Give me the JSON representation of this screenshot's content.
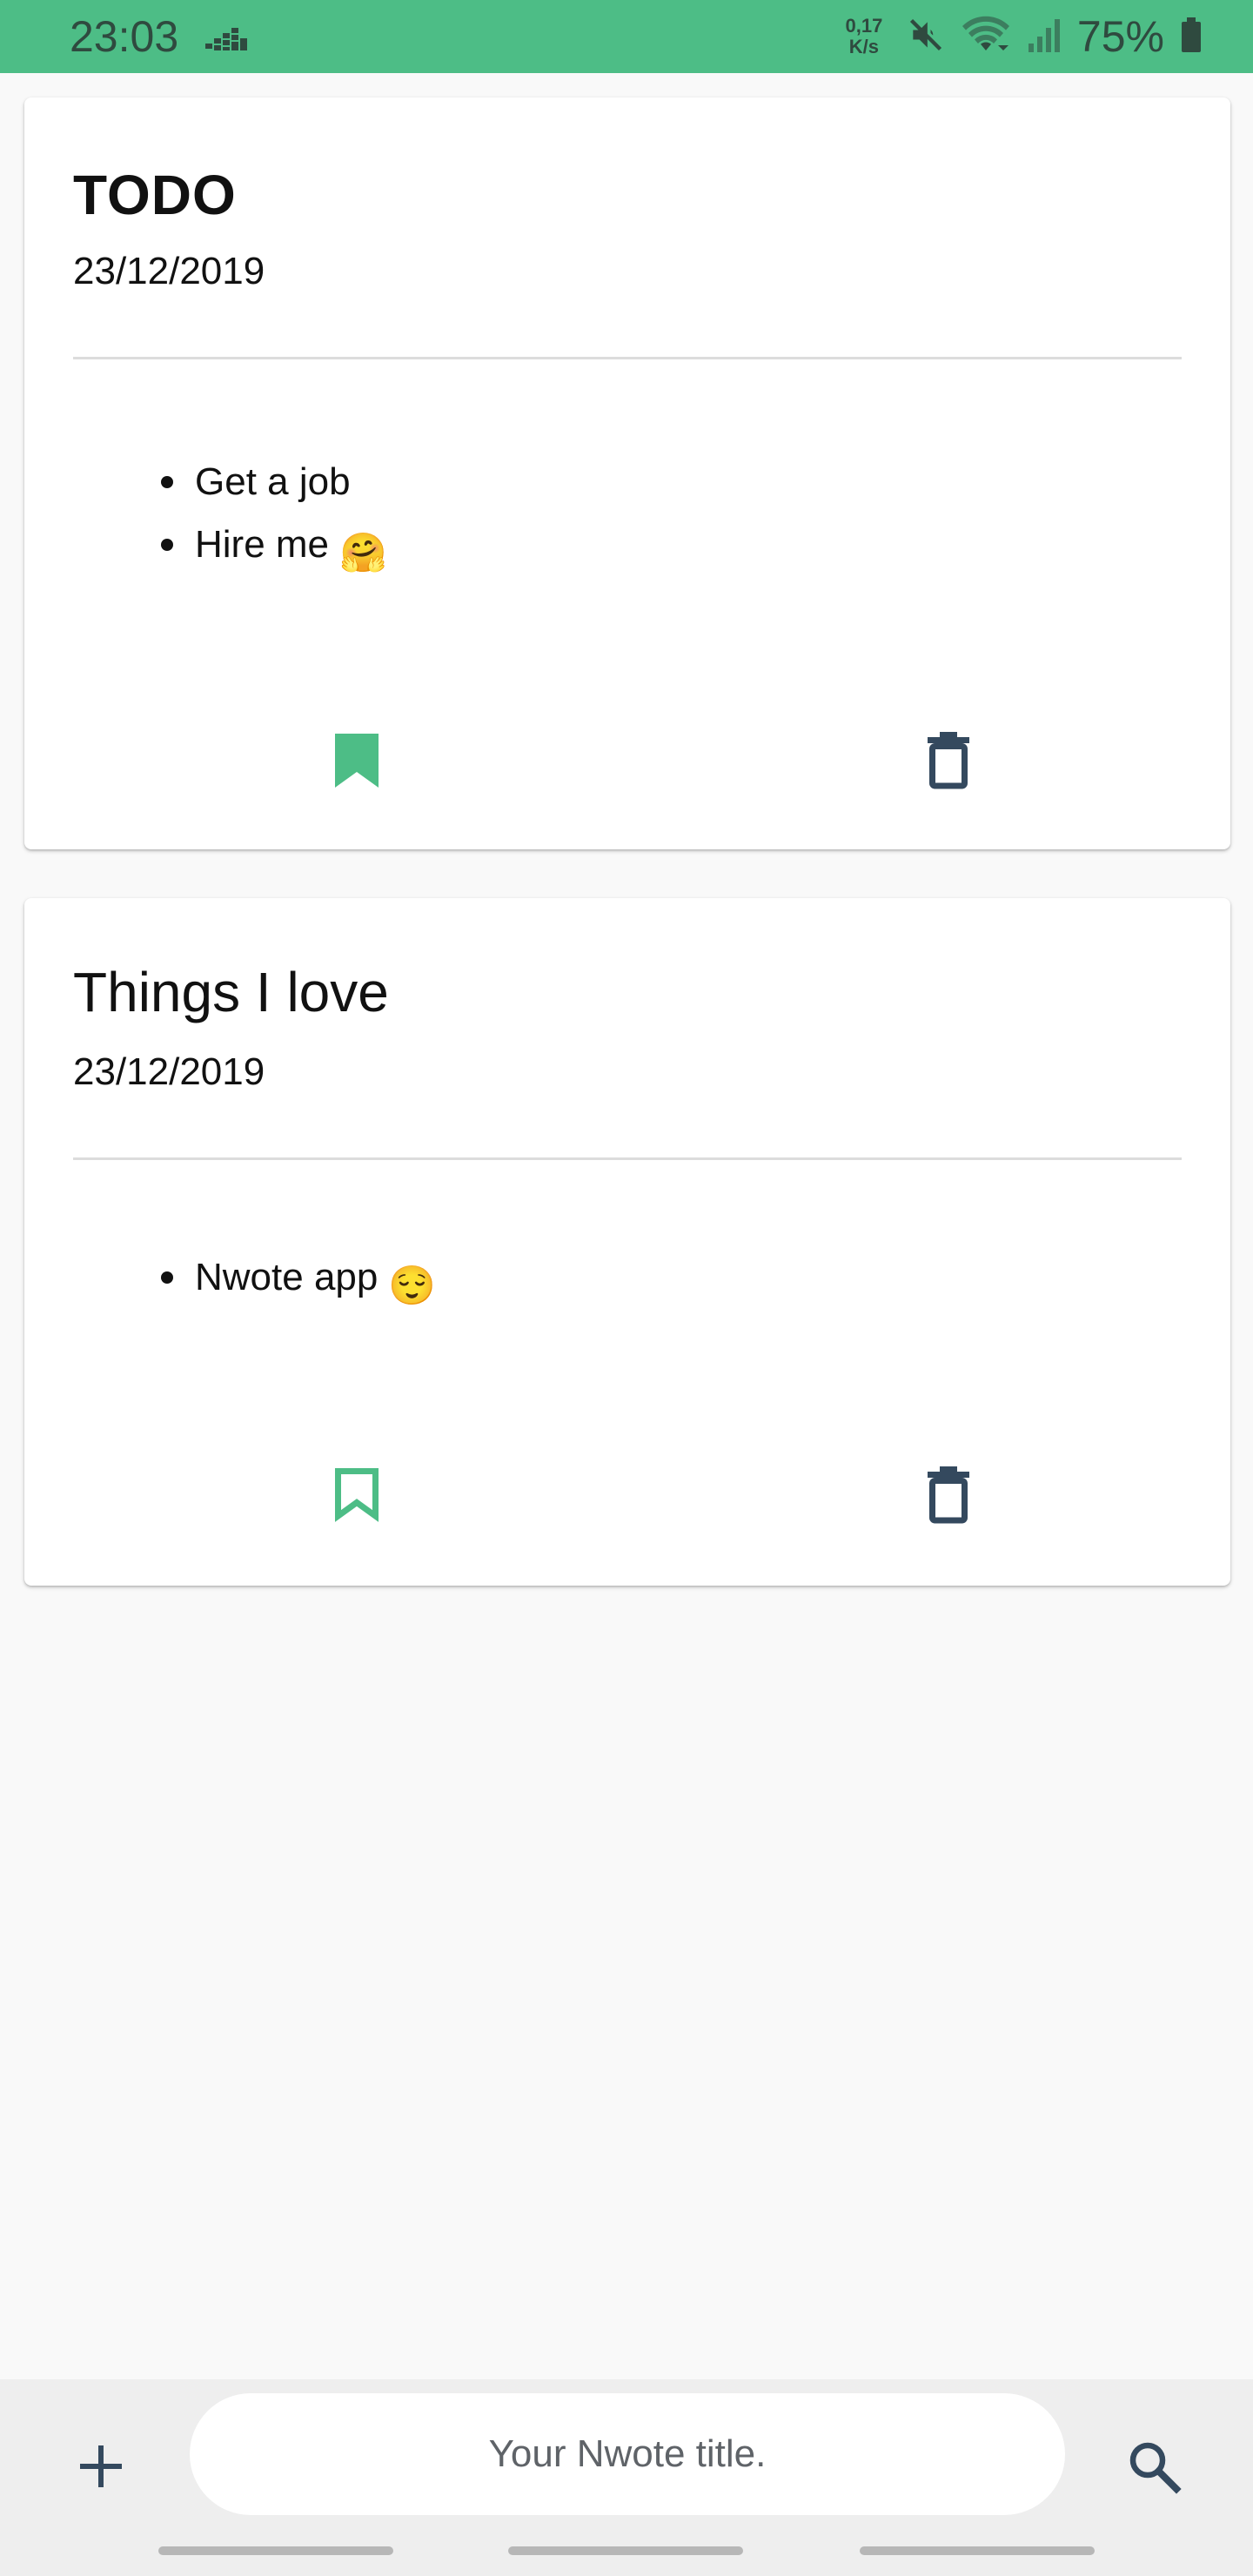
{
  "status_bar": {
    "time": "23:03",
    "net_speed_value": "0,17",
    "net_speed_unit": "K/s",
    "battery": "75%",
    "icons": [
      "deezer-icon",
      "mute-icon",
      "wifi-icon",
      "signal-icon",
      "battery-icon"
    ]
  },
  "notes": [
    {
      "title": "TODO",
      "date": "23/12/2019",
      "items": [
        "Get a job",
        "Hire me"
      ],
      "item_emojis": [
        "",
        "🤗"
      ],
      "bookmarked": true
    },
    {
      "title": "Things I love",
      "date": "23/12/2019",
      "items": [
        "Nwote app"
      ],
      "item_emojis": [
        "😌"
      ],
      "bookmarked": false
    }
  ],
  "bottom_bar": {
    "title_input_placeholder": "Your Nwote title.",
    "title_input_value": "",
    "icons": [
      "add-icon",
      "search-icon"
    ]
  },
  "colors": {
    "accent": "#4dbd86",
    "icon_dark": "#34495e",
    "background": "#f9f9f9",
    "bottom_bar": "#eeeeee"
  }
}
